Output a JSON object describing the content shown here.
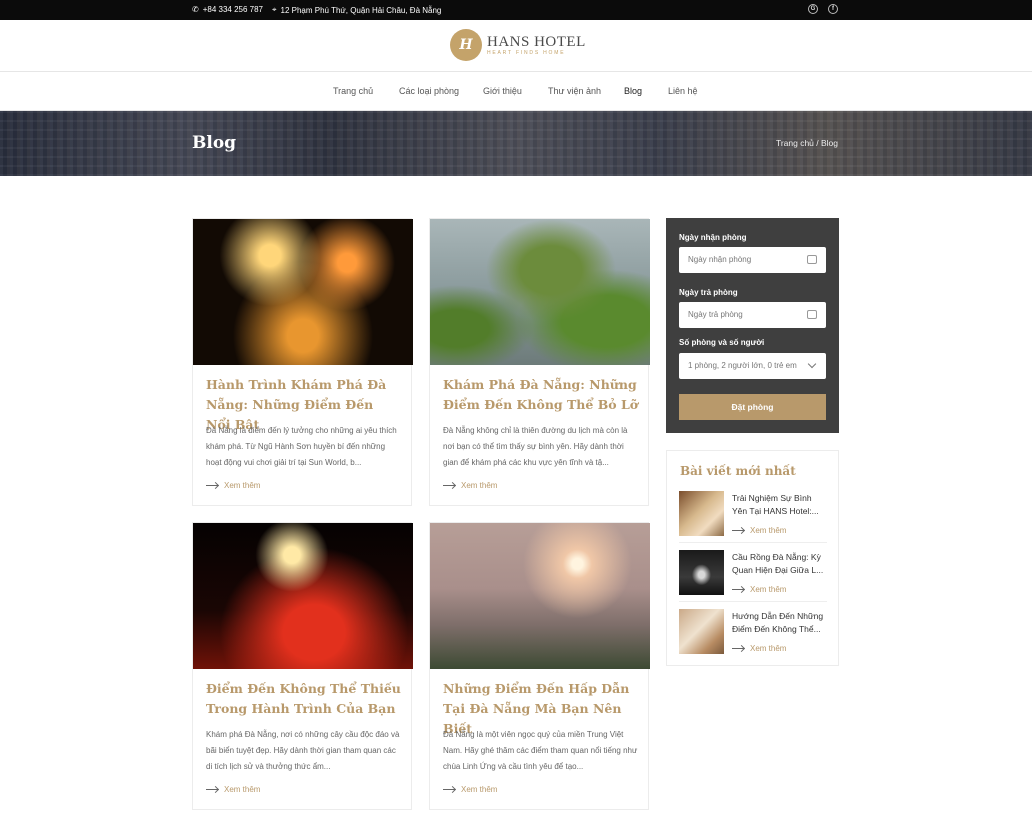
{
  "topbar": {
    "phone": "+84 334 256 787",
    "address": "12 Phạm Phú Thứ, Quận Hải Châu, Đà Nẵng",
    "social": [
      "google-icon",
      "facebook-icon"
    ]
  },
  "logo": {
    "monogram": "H",
    "name": "HANS HOTEL",
    "tagline": "HEART FINDS HOME"
  },
  "nav": {
    "items": [
      "Trang chủ",
      "Các loại phòng",
      "Giới thiệu",
      "Thư viện ảnh",
      "Blog",
      "Liên hệ"
    ],
    "active": "Blog"
  },
  "banner": {
    "title": "Blog",
    "breadcrumb": "Trang chủ / Blog"
  },
  "posts": [
    {
      "title": "Hành Trình Khám Phá Đà Nẵng: Những Điểm Đến Nổi Bật",
      "excerpt": "Đà Nẵng là điểm đến lý tưởng cho những ai yêu thích khám phá. Từ Ngũ Hành Sơn huyền bí đến những hoạt động vui chơi giải trí tại Sun World, b...",
      "more": "Xem thêm"
    },
    {
      "title": "Khám Phá Đà Nẵng: Những Điểm Đến Không Thể Bỏ Lỡ",
      "excerpt": "Đà Nẵng không chỉ là thiên đường du lịch mà còn là nơi bạn có thể tìm thấy sự bình yên. Hãy dành thời gian để khám phá các khu vực yên tĩnh và tậ...",
      "more": "Xem thêm"
    },
    {
      "title": "Điểm Đến Không Thể Thiếu Trong Hành Trình Của Bạn",
      "excerpt": "Khám phá Đà Nẵng, nơi có những cây cầu độc đáo và bãi biển tuyệt đẹp. Hãy dành thời gian tham quan các di tích lịch sử và thưởng thức ẩm...",
      "more": "Xem thêm"
    },
    {
      "title": "Những Điểm Đến Hấp Dẫn Tại Đà Nẵng Mà Bạn Nên Biết",
      "excerpt": "Đà Nẵng là một viên ngọc quý của miền Trung Việt Nam. Hãy ghé thăm các điểm tham quan nổi tiếng như chùa Linh Ứng và cầu tình yêu để tạo...",
      "more": "Xem thêm"
    }
  ],
  "booking": {
    "checkin_label": "Ngày nhận phòng",
    "checkin_placeholder": "Ngày nhận phòng",
    "checkout_label": "Ngày trả phòng",
    "checkout_placeholder": "Ngày trả phòng",
    "rooms_label": "Số phòng và số người",
    "rooms_value": "1 phòng, 2 người lớn, 0 trẻ em",
    "submit": "Đặt phòng"
  },
  "recent": {
    "heading": "Bài viết mới nhất",
    "items": [
      {
        "title": "Trải Nghiệm Sự Bình Yên Tại HANS Hotel:...",
        "more": "Xem thêm"
      },
      {
        "title": "Cầu Rồng Đà Nẵng: Kỳ Quan Hiện Đại Giữa L...",
        "more": "Xem thêm"
      },
      {
        "title": "Hướng Dẫn Đến Những Điểm Đến Không Thể...",
        "more": "Xem thêm"
      }
    ]
  },
  "colors": {
    "accent": "#b8996b",
    "topbar": "#0b0b0b",
    "booking_bg": "#3f3f3f"
  }
}
